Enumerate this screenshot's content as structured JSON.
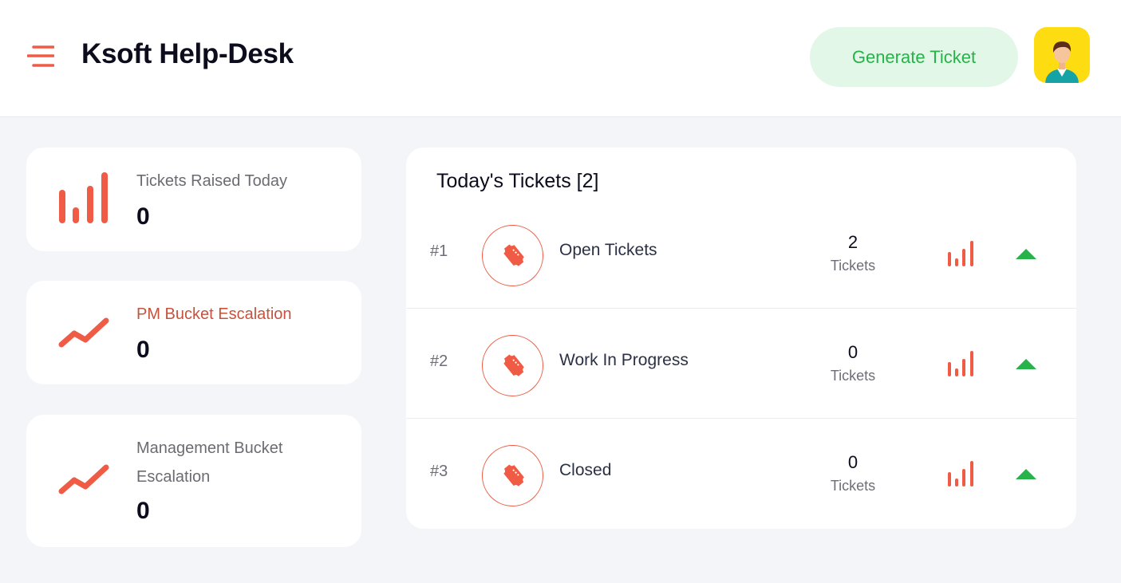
{
  "header": {
    "title": "Ksoft Help-Desk",
    "generate_label": "Generate Ticket",
    "menu_icon": "hamburger-menu-icon",
    "avatar_icon": "user-avatar-icon"
  },
  "stats": [
    {
      "label": "Tickets Raised Today",
      "value": "0",
      "icon": "bar-chart-icon"
    },
    {
      "label": "PM Bucket Escalation",
      "value": "0",
      "icon": "trend-line-icon"
    },
    {
      "label_line1": "Management Bucket",
      "label_line2": "Escalation",
      "value": "0",
      "icon": "trend-line-icon"
    }
  ],
  "panel": {
    "title": "Today's Tickets [2]",
    "rows": [
      {
        "index": "#1",
        "name": "Open Tickets",
        "count": "2",
        "unit": "Tickets"
      },
      {
        "index": "#2",
        "name": "Work In Progress",
        "count": "0",
        "unit": "Tickets"
      },
      {
        "index": "#3",
        "name": "Closed",
        "count": "0",
        "unit": "Tickets"
      }
    ]
  },
  "colors": {
    "accent": "#ef5b45",
    "green": "#27b24a",
    "green_bg": "#e3f7e8",
    "avatar_bg": "#fddc11"
  }
}
